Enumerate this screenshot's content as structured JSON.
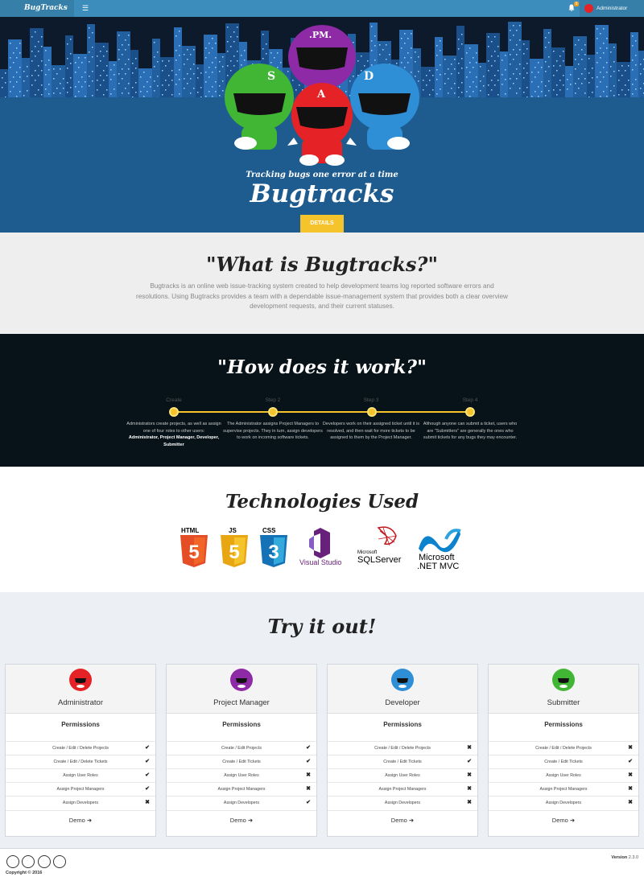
{
  "navbar": {
    "logo": "BugTracks",
    "menu_icon": "menu-icon",
    "notification_count": "9",
    "user_name": "Administrator"
  },
  "hero": {
    "tagline": "Tracking bugs one error at a time",
    "title": "Bugtracks",
    "details_label": "DETAILS",
    "mascots": [
      {
        "letter": "S",
        "color": "#41b635"
      },
      {
        "letter": ".PM.",
        "color": "#8e2aa5"
      },
      {
        "letter": "A",
        "color": "#e52226"
      },
      {
        "letter": "D",
        "color": "#2f8fd6"
      }
    ]
  },
  "what": {
    "title": "\"What is Bugtracks?\"",
    "body": "Bugtracks is an online web issue-tracking system created to help development teams log reported software errors and resolutions. Using Bugtracks provides a team with a dependable issue-management system that provides both a clear overview development requests, and their current statuses."
  },
  "how": {
    "title": "\"How does it work?\"",
    "steps": [
      {
        "label": "Create",
        "desc": "Administrators create projects, as well as assign one of four roles to other users:",
        "roles": "Administrator, Project Manager, Developer, Submitter"
      },
      {
        "label": "Step 2",
        "desc": "The Administrator assigns Project Managers to supervise projects. They in turn, assign developers to work on incoming software tickets."
      },
      {
        "label": "Step 3",
        "desc": "Developers work on their assigned ticket until it is resolved, and then wait for more tickets to be assigned to them by the Project Manager."
      },
      {
        "label": "Step 4",
        "desc": "Although anyone can submit a ticket, users who are \"Submitters\" are generally the ones who submit tickets for any bugs they may encounter."
      }
    ]
  },
  "tech": {
    "title": "Technologies Used",
    "logos": {
      "html": "HTML",
      "html_num": "5",
      "js": "JS",
      "js_num": "5",
      "css": "CSS",
      "css_num": "3",
      "vs": "Visual Studio",
      "sql_top": "Microsoft",
      "sql": "SQLServer",
      "net_top": "Microsoft",
      "net": ".NET MVC"
    }
  },
  "try": {
    "title": "Try it out!",
    "permissions_title": "Permissions",
    "demo_label": "Demo",
    "permission_names": [
      "Create / Edit / Delete Projects",
      "Create / Edit / Delete Tickets",
      "Assign User Roles",
      "Assign Project Managers",
      "Assign Developers"
    ],
    "cards": [
      {
        "role": "Administrator",
        "color": "#e52226",
        "perms": [
          "Create / Edit / Delete Projects",
          "Create / Edit / Delete Tickets",
          "Assign User Roles",
          "Assign Project Managers",
          "Assign Developers"
        ],
        "marks": [
          "✔",
          "✔",
          "✔",
          "✔",
          "✖"
        ]
      },
      {
        "role": "Project Manager",
        "color": "#8e2aa5",
        "perms": [
          "Create / Edit Projects",
          "Create / Edit Tickets",
          "Assign User Roles",
          "Assign Project Managers",
          "Assign Developers"
        ],
        "marks": [
          "✔",
          "✔",
          "✖",
          "✖",
          "✔"
        ]
      },
      {
        "role": "Developer",
        "color": "#2f8fd6",
        "perms": [
          "Create / Edit / Delete Projects",
          "Create / Edit Tickets",
          "Assign User Roles",
          "Assign Project Managers",
          "Assign Developers"
        ],
        "marks": [
          "✖",
          "✔",
          "✖",
          "✖",
          "✖"
        ]
      },
      {
        "role": "Submitter",
        "color": "#41b635",
        "perms": [
          "Create / Edit / Delete Projects",
          "Create / Edit Tickets",
          "Assign User Roles",
          "Assign Project Managers",
          "Assign Developers"
        ],
        "marks": [
          "✖",
          "✔",
          "✖",
          "✖",
          "✖"
        ]
      }
    ]
  },
  "footer": {
    "copyright": "Copyright © 2016",
    "version_label": "Version",
    "version": "2.3.0"
  }
}
